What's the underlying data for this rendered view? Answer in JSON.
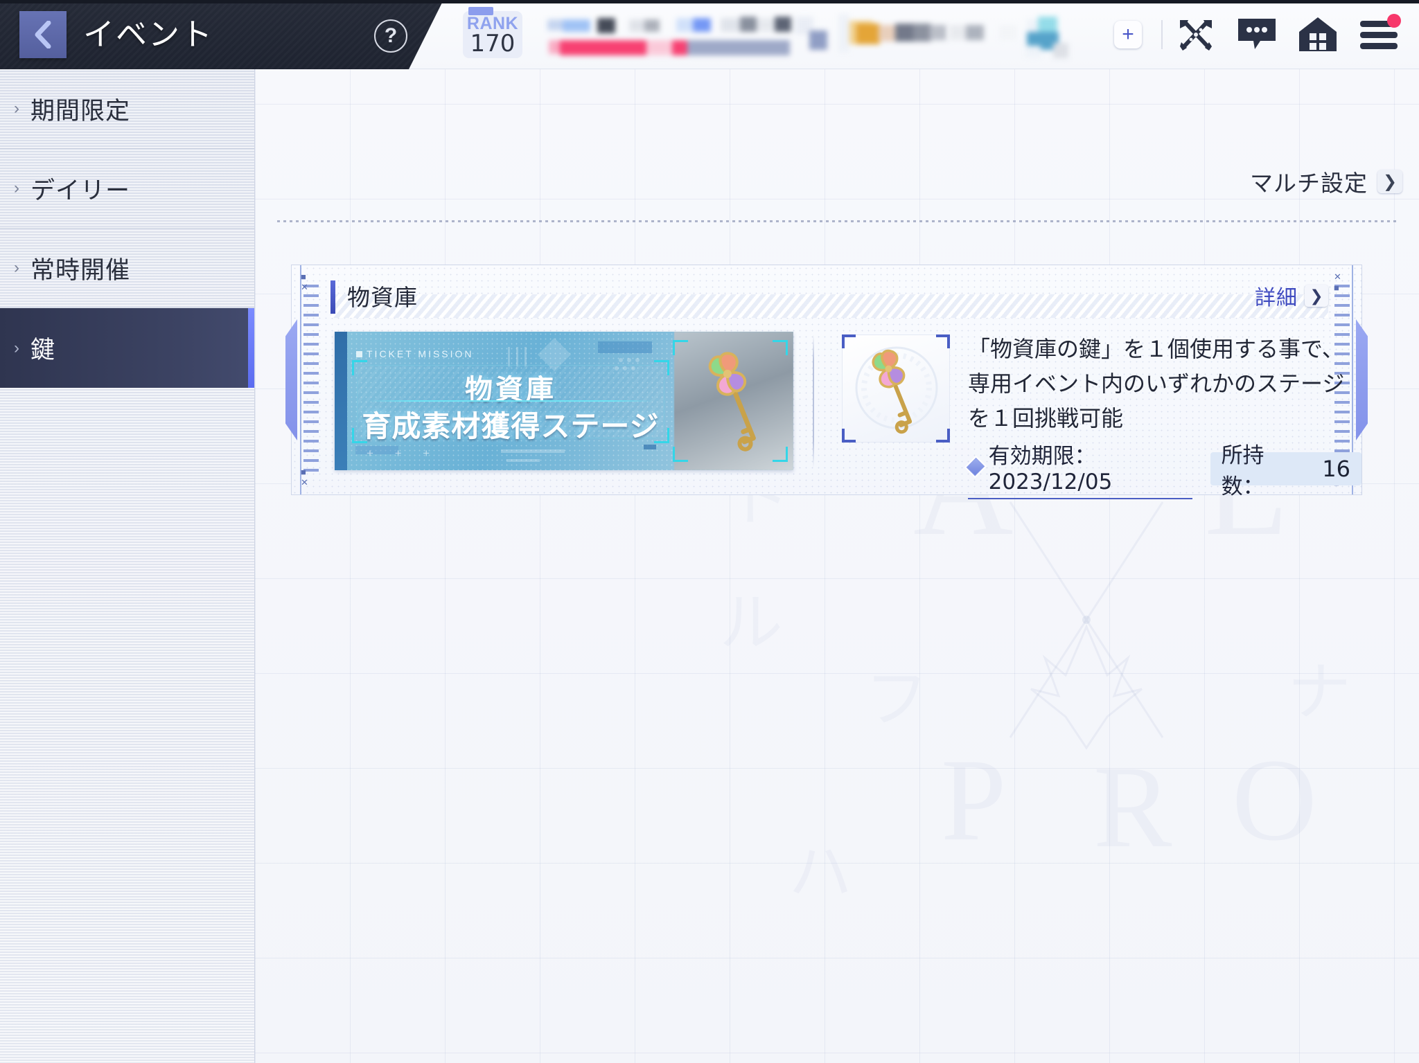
{
  "header": {
    "back_icon": "chevron-left-icon",
    "title": "イベント",
    "help_icon": "question-mark-icon",
    "rank_label": "RANK",
    "rank_value": "170",
    "plus_icon": "plus-icon",
    "weapons_icon": "crossed-weapons-icon",
    "chat_icon": "chat-bubble-icon",
    "home_icon": "home-icon",
    "menu_icon": "hamburger-menu-icon"
  },
  "sidebar": {
    "items": [
      {
        "label": "期間限定",
        "active": false
      },
      {
        "label": "デイリー",
        "active": false
      },
      {
        "label": "常時開催",
        "active": false
      },
      {
        "label": "鍵",
        "active": true
      }
    ]
  },
  "main": {
    "multi_settings_label": "マルチ設定",
    "multi_settings_icon": "chevron-right-icon"
  },
  "card": {
    "title": "物資庫",
    "details_label": "詳細",
    "details_icon": "chevron-right-icon",
    "banner": {
      "tag": "TICKET MISSION",
      "title": "物資庫",
      "subtitle": "育成素材獲得ステージ",
      "art_icon": "golden-key-icon"
    },
    "item_icon": "golden-key-item-icon",
    "description": "「物資庫の鍵」を１個使用する事で、専用イベント内のいずれかのステージを１回挑戦可能",
    "expiry_label": "有効期限：2023/12/05",
    "expiry_icon": "diamond-icon",
    "count_label": "所持数：",
    "count_value": "16"
  },
  "watermark": {
    "letters": [
      "A",
      "L",
      "P",
      "R",
      "O"
    ],
    "kana": [
      "ト",
      "ル",
      "フ",
      "ナ",
      "ハ"
    ]
  },
  "colors": {
    "accent_blue": "#4a5ec4",
    "header_dark": "#262b38",
    "sidebar_active": "#3c4363",
    "notification": "#f7386b",
    "banner_cyan": "#34d6e8"
  }
}
